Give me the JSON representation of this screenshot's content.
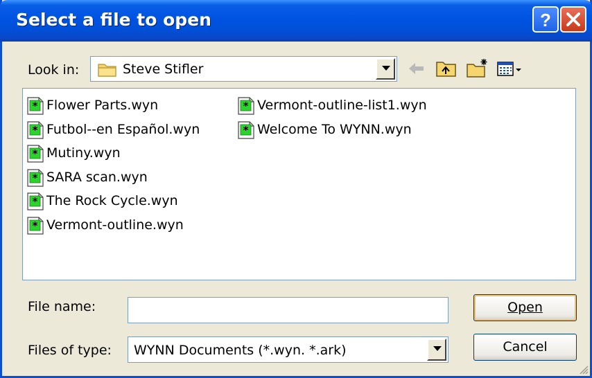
{
  "window": {
    "title": "Select a file to open",
    "help_label": "?",
    "close_label": "X"
  },
  "look_in": {
    "label": "Look in:",
    "folder": "Steve Stifler"
  },
  "toolbar": {
    "icons": [
      "back-arrow-icon",
      "up-one-level-icon",
      "create-new-folder-icon",
      "view-menu-icon"
    ]
  },
  "files": {
    "column1": [
      "Flower Parts.wyn",
      "Futbol--en Español.wyn",
      "Mutiny.wyn",
      "SARA scan.wyn",
      "The Rock Cycle.wyn",
      "Vermont-outline.wyn"
    ],
    "column2": [
      "Vermont-outline-list1.wyn",
      "Welcome To WYNN.wyn"
    ]
  },
  "file_name": {
    "label": "File name:",
    "value": ""
  },
  "file_type": {
    "label": "Files of type:",
    "selected": "WYNN Documents (*.wyn. *.ark)"
  },
  "buttons": {
    "open_label": "Open",
    "cancel_label": "Cancel"
  },
  "colors": {
    "titlebar": "#0054E3",
    "dialog_bg": "#ECE9D8",
    "close_button": "#C8391A"
  }
}
